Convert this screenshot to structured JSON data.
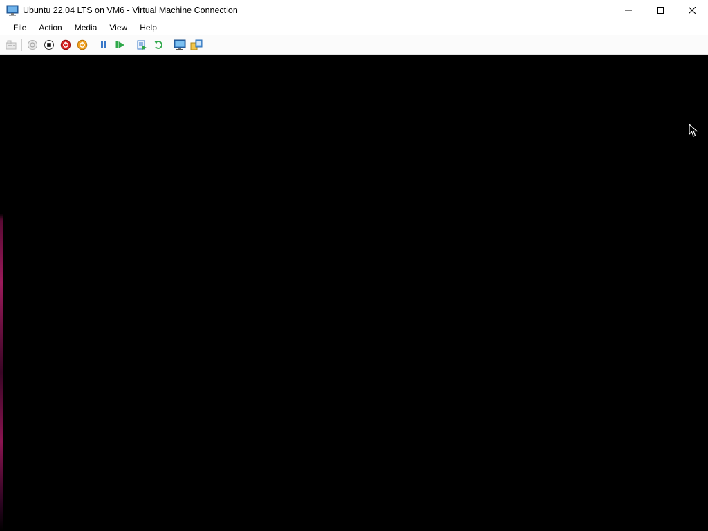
{
  "window": {
    "title": "Ubuntu 22.04 LTS on VM6 - Virtual Machine Connection",
    "app_icon": "vm-monitor-icon",
    "controls": [
      "minimize-icon",
      "maximize-icon",
      "close-icon"
    ]
  },
  "menu": {
    "items": [
      {
        "label": "File"
      },
      {
        "label": "Action"
      },
      {
        "label": "Media"
      },
      {
        "label": "View"
      },
      {
        "label": "Help"
      }
    ]
  },
  "toolbar": {
    "groups": [
      [
        "ctrl-alt-del-icon"
      ],
      [
        "start-icon",
        "turn-off-icon",
        "shut-down-icon",
        "save-icon"
      ],
      [
        "pause-icon",
        "resume-icon"
      ],
      [
        "checkpoint-icon",
        "revert-icon"
      ],
      [
        "enhanced-session-icon",
        "share-icon"
      ]
    ]
  },
  "vm_screen": {
    "background": "#000000"
  },
  "colors": {
    "shutdown_red": "#d42020",
    "save_orange": "#f0a020",
    "pause_blue": "#3a78c8",
    "resume_green": "#2fa84a"
  }
}
